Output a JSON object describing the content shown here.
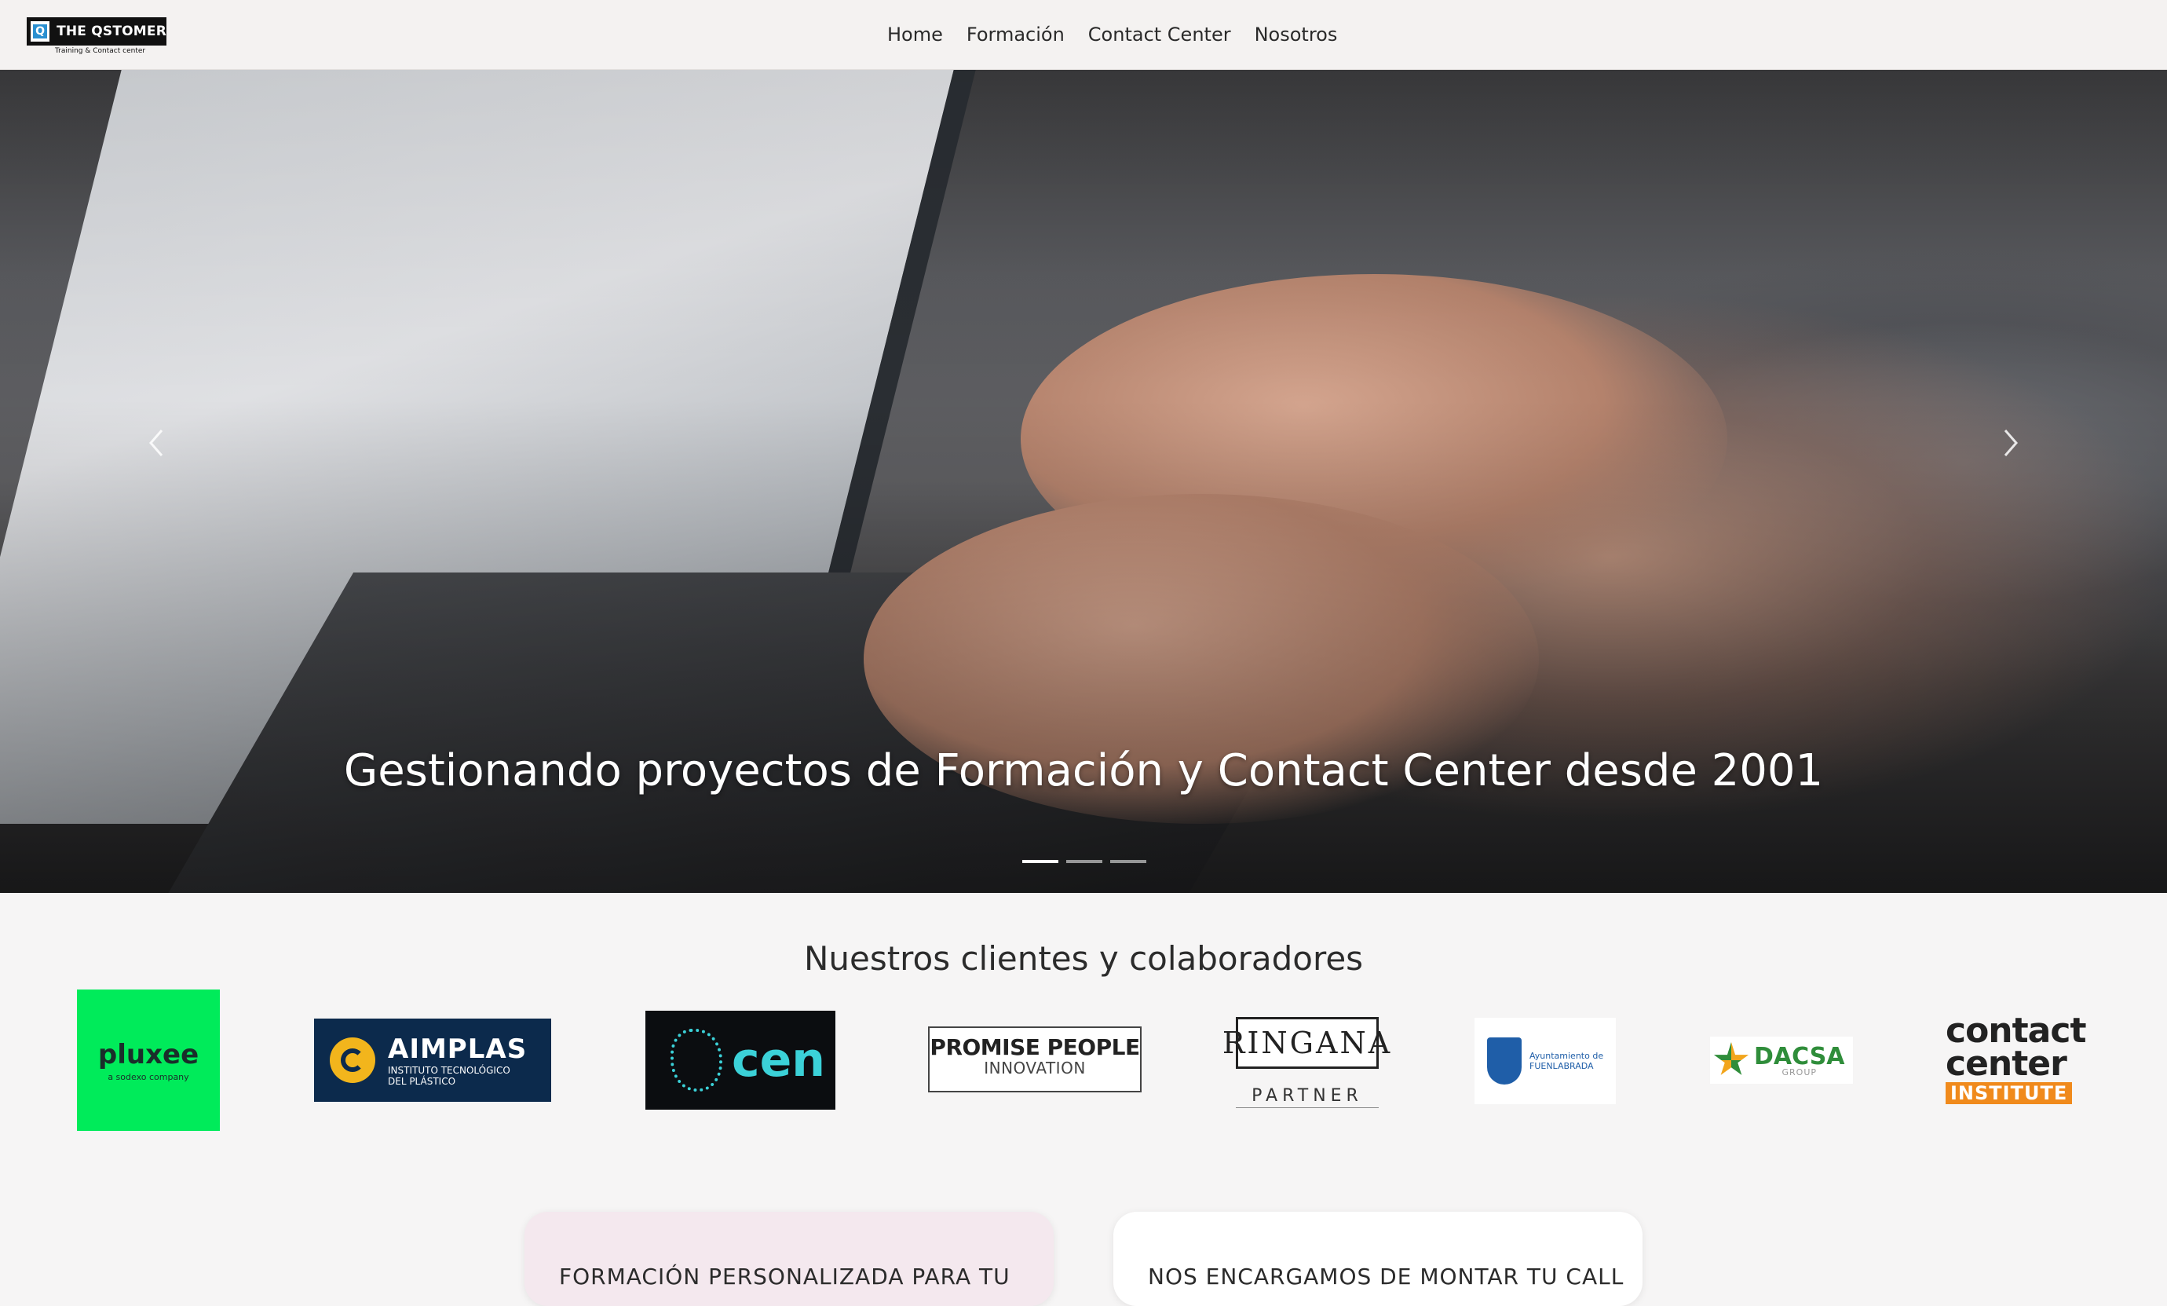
{
  "brand": {
    "name": "THE QSTOMER",
    "mark": "Q",
    "tagline": "Training & Contact center"
  },
  "nav": {
    "items": [
      "Home",
      "Formación",
      "Contact Center",
      "Nosotros"
    ]
  },
  "hero": {
    "caption": "Gestionando proyectos de Formación y Contact Center desde 2001",
    "slides": 3,
    "active_slide": 1
  },
  "clients": {
    "title": "Nuestros clientes y colaboradores",
    "logos": {
      "pluxee": {
        "main": "pluxee",
        "sub": "a sodexo company"
      },
      "aimplas": {
        "main": "AIMPLAS",
        "line1": "INSTITUTO TECNOLÓGICO",
        "line2": "DEL PLÁSTICO"
      },
      "cen": {
        "main": "cen"
      },
      "promise": {
        "line1": "PROMISE PEOPLE",
        "line2": "INNOVATION"
      },
      "ringana": {
        "main": "RINGANA",
        "sub": "PARTNER"
      },
      "fuenlabrada": {
        "line1": "Ayuntamiento de",
        "line2": "FUENLABRADA"
      },
      "dacsa": {
        "main": "DACSA",
        "sub": "GROUP"
      },
      "cci": {
        "line1": "contact",
        "line2": "center",
        "line3": "INSTITUTE"
      }
    }
  },
  "cards": {
    "left": "FORMACIÓN PERSONALIZADA PARA TU",
    "right": "NOS ENCARGAMOS DE MONTAR TU CALL"
  },
  "colors": {
    "pluxee": "#00eb5a",
    "aimplas": "#0c2a4c",
    "cen_accent": "#3bd1d8",
    "dacsa_green": "#2f8d3a",
    "cci_orange": "#f08a1c",
    "card_left": "#f4e8ee"
  }
}
